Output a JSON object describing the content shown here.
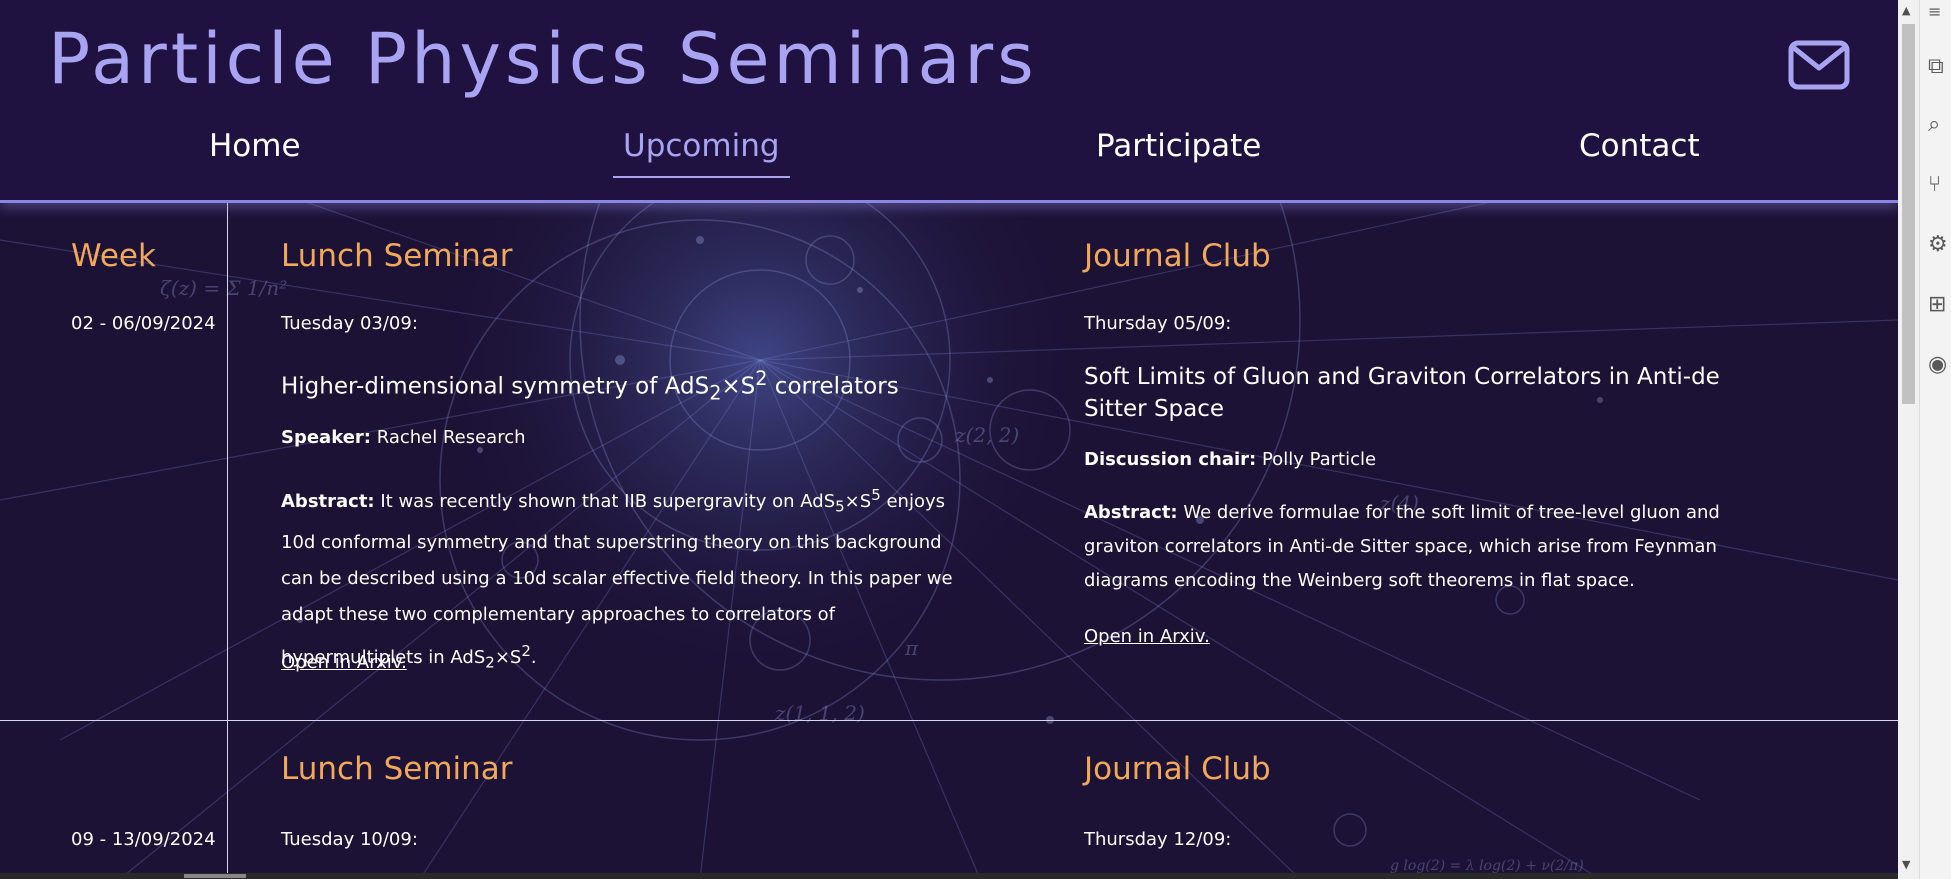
{
  "site": {
    "title": "Particle Physics Seminars",
    "icons": {
      "contact": "envelope-icon"
    }
  },
  "nav": {
    "items": [
      {
        "label": "Home",
        "active": false
      },
      {
        "label": "Upcoming",
        "active": true
      },
      {
        "label": "Participate",
        "active": false
      },
      {
        "label": "Contact",
        "active": false
      }
    ]
  },
  "columns": {
    "week": "Week",
    "lunch": "Lunch Seminar",
    "journal": "Journal Club"
  },
  "weeks": [
    {
      "dates": "02 - 06/09/2024",
      "lunch": {
        "day": "Tuesday 03/09:",
        "title_parts": [
          "Higher-dimensional symmetry of AdS",
          "2",
          "×S",
          "2",
          " correlators"
        ],
        "speaker_label": "Speaker:",
        "speaker": "Rachel Research",
        "abstract_label": "Abstract:",
        "abstract_parts": [
          "It was recently shown that IIB supergravity on AdS",
          "5",
          "×S",
          "5",
          " enjoys 10d conformal symmetry and that superstring theory on this background can be described using a 10d scalar effective field theory. In this paper we adapt these two complementary approaches to correlators of hypermultiplets in AdS",
          "2",
          "×S",
          "2",
          "."
        ],
        "link": "Open in Arxiv."
      },
      "journal": {
        "day": "Thursday 05/09:",
        "title": "Soft Limits of Gluon and Graviton Correlators in Anti-de Sitter Space",
        "chair_label": "Discussion chair:",
        "chair": "Polly Particle",
        "abstract_label": "Abstract:",
        "abstract": "We derive formulae for the soft limit of tree-level gluon and graviton correlators in Anti-de Sitter space, which arise from Feynman diagrams encoding the Weinberg soft theorems in flat space.",
        "link": "Open in Arxiv."
      }
    },
    {
      "dates": "09 - 13/09/2024",
      "lunch": {
        "day": "Tuesday 10/09:"
      },
      "journal": {
        "day": "Thursday 12/09:"
      }
    }
  ],
  "colors": {
    "background": "#1e1238",
    "title": "#a8a4f2",
    "heading": "#f2a85a",
    "divider": "#d8d6ee"
  }
}
